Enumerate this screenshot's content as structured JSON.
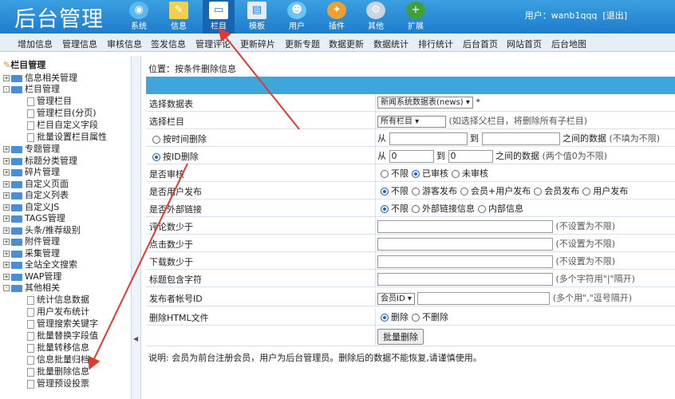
{
  "app": {
    "logo": "后台管理",
    "user_label": "用户：wanb1qqq",
    "logout": "[退出]"
  },
  "top_tabs": [
    "系统",
    "信息",
    "栏目",
    "模板",
    "用户",
    "插件",
    "其他",
    "扩展"
  ],
  "subnav": [
    "增加信息",
    "管理信息",
    "审核信息",
    "签发信息",
    "管理评论",
    "更新碎片",
    "更新专题",
    "数据更新",
    "数据统计",
    "排行统计",
    "后台首页",
    "网站首页",
    "后台地图"
  ],
  "sidebar": {
    "root": "栏目管理",
    "items": [
      "信息相关管理",
      "栏目管理",
      "管理栏目",
      "管理栏目(分页)",
      "栏目自定义字段",
      "批量设置栏目属性",
      "专题管理",
      "标题分类管理",
      "碎片管理",
      "自定义页面",
      "自定义列表",
      "自定义JS",
      "TAGS管理",
      "头条/推荐级别",
      "附件管理",
      "采集管理",
      "全站全文搜索",
      "WAP管理",
      "其他相关",
      "统计信息数据",
      "用户发布统计",
      "管理搜索关键字",
      "批量替换字段值",
      "批量转移信息",
      "信息批量归档",
      "批量删除信息",
      "管理预设投票"
    ]
  },
  "position": "位置：按条件删除信息",
  "form": {
    "table_label": "选择数据表",
    "table_value": "新闻系统数据表(news)",
    "table_mark": "*",
    "column_label": "选择栏目",
    "column_value": "所有栏目",
    "column_hint": "(如选择父栏目，将删除所有子栏目)",
    "time_label": "按时间删除",
    "from": "从",
    "to": "到",
    "time_hint": "之间的数据",
    "time_hint2": "(不填为不限)",
    "id_label": "按ID删除",
    "id_from": "0",
    "id_to": "0",
    "id_hint": "之间的数据",
    "id_hint2": "(两个值0为不限)",
    "audit_label": "是否审核",
    "audit_opts": [
      "不限",
      "已审核",
      "未审核"
    ],
    "user_label": "是否用户发布",
    "user_opts": [
      "不限",
      "游客发布",
      "会员+用户发布",
      "会员发布",
      "用户发布"
    ],
    "link_label": "是否外部链接",
    "link_opts": [
      "不限",
      "外部链接信息",
      "内部信息"
    ],
    "comments_label": "评论数少于",
    "clicks_label": "点击数少于",
    "downloads_label": "下载数少于",
    "unlimited_hint": "(不设置为不限)",
    "title_label": "标题包含字符",
    "title_hint": "(多个字符用\"|\"隔开)",
    "poster_label": "发布者帐号ID",
    "poster_select": "会员ID",
    "poster_hint": "(多个用\",\"逗号隔开)",
    "html_label": "删除HTML文件",
    "html_opts": [
      "删除",
      "不删除"
    ],
    "submit": "批量删除"
  },
  "note": "说明: 会员为前台注册会员，用户为后台管理员。删除后的数据不能恢复,请谨慎使用。",
  "colors": {
    "top": "#2a8ad6",
    "header_bar": "#3fa6dc",
    "annotation": "#e03a2f"
  }
}
